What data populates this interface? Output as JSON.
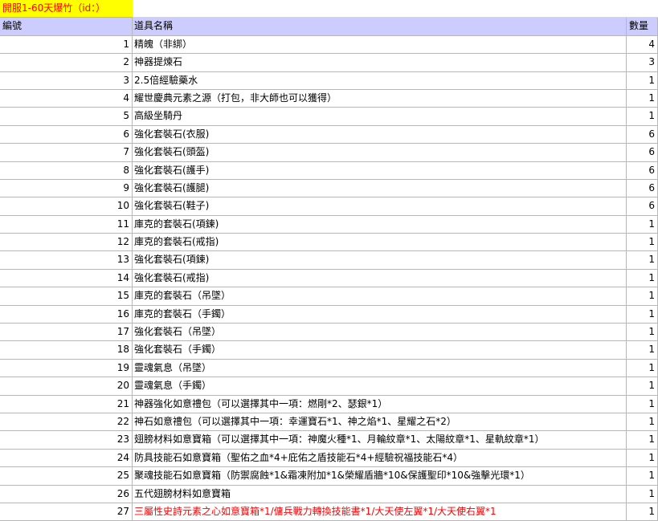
{
  "title": "開服1-60天爆竹（id：）",
  "headers": {
    "id": "編號",
    "name": "道具名稱",
    "qty": "數量"
  },
  "rows": [
    {
      "id": "1",
      "name": "精魄（非綁）",
      "qty": "4"
    },
    {
      "id": "2",
      "name": "神器提煉石",
      "qty": "3"
    },
    {
      "id": "3",
      "name": "2.5倍經驗藥水",
      "qty": "1"
    },
    {
      "id": "4",
      "name": "耀世慶典元素之源（打包，非大師也可以獲得）",
      "qty": "1"
    },
    {
      "id": "5",
      "name": "高級坐騎丹",
      "qty": "1"
    },
    {
      "id": "6",
      "name": "強化套裝石(衣服)",
      "qty": "6"
    },
    {
      "id": "7",
      "name": "強化套裝石(頭盔)",
      "qty": "6"
    },
    {
      "id": "8",
      "name": "強化套裝石(護手)",
      "qty": "6"
    },
    {
      "id": "9",
      "name": "強化套裝石(護腿)",
      "qty": "6"
    },
    {
      "id": "10",
      "name": "強化套裝石(鞋子)",
      "qty": "6"
    },
    {
      "id": "11",
      "name": "庫克的套裝石(項鍊)",
      "qty": "1"
    },
    {
      "id": "12",
      "name": "庫克的套裝石(戒指)",
      "qty": "1"
    },
    {
      "id": "13",
      "name": "強化套裝石(項鍊)",
      "qty": "1"
    },
    {
      "id": "14",
      "name": "強化套裝石(戒指)",
      "qty": "1"
    },
    {
      "id": "15",
      "name": "庫克的套裝石（吊墜）",
      "qty": "1"
    },
    {
      "id": "16",
      "name": "庫克的套裝石（手鐲）",
      "qty": "1"
    },
    {
      "id": "17",
      "name": "強化套裝石（吊墜）",
      "qty": "1"
    },
    {
      "id": "18",
      "name": "強化套裝石（手鐲）",
      "qty": "1"
    },
    {
      "id": "19",
      "name": "靈魂氣息（吊墜）",
      "qty": "1"
    },
    {
      "id": "20",
      "name": "靈魂氣息（手鐲）",
      "qty": "1"
    },
    {
      "id": "21",
      "name": "神器強化如意禮包（可以選擇其中一項：燃剛*2、瑟銀*1）",
      "qty": "1"
    },
    {
      "id": "22",
      "name": "神石如意禮包（可以選擇其中一項：幸運寶石*1、神之焰*1、星耀之石*2）",
      "qty": "1"
    },
    {
      "id": "23",
      "name": "翅膀材料如意寶箱（可以選擇其中一項：神魔火種*1、月輪紋章*1、太陽紋章*1、星軌紋章*1）",
      "qty": "1"
    },
    {
      "id": "24",
      "name": "防具技能石如意寶箱（聖佑之血*4+庇佑之盾技能石*4+經驗祝福技能石*4）",
      "qty": "1"
    },
    {
      "id": "25",
      "name": "聚魂技能石如意寶箱（防禦腐蝕*1&霜凍附加*1&榮耀盾牆*10&保護聖印*10&強擊光環*1）",
      "qty": "1"
    },
    {
      "id": "26",
      "name": "五代翅膀材料如意寶箱",
      "qty": "1"
    },
    {
      "id": "27",
      "name": "三屬性史詩元素之心如意寶箱*1/傭兵戰力轉換技能書*1/大天使左翼*1/大天使右翼*1",
      "qty": "1",
      "highlight": true
    }
  ],
  "colors": {
    "title_bg": "#ffff00",
    "title_text": "#ff0000",
    "header_bg": "#ccccff",
    "highlight_text": "#ff0000"
  }
}
